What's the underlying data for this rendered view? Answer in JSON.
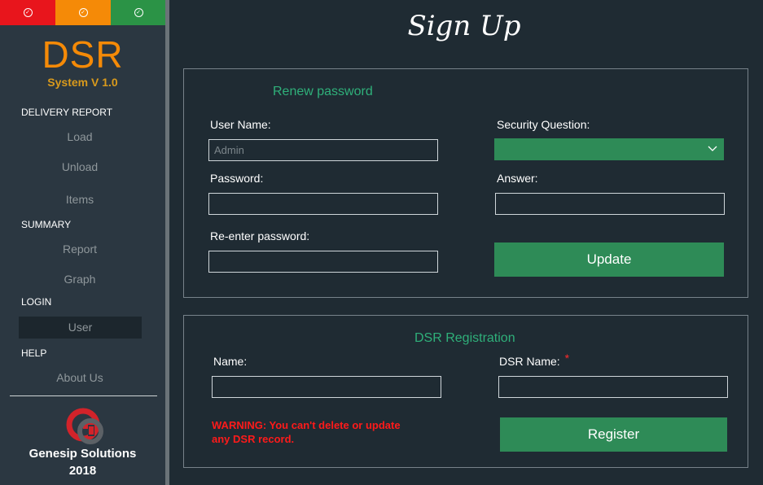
{
  "window_controls": [
    {
      "name": "close",
      "color": "#e8151c"
    },
    {
      "name": "minimize",
      "color": "#f58a07"
    },
    {
      "name": "maximize",
      "color": "#2b9346"
    }
  ],
  "sidebar": {
    "logo_text": "DSR",
    "logo_sub": "System V 1.0",
    "sections": [
      {
        "heading": "DELIVERY REPORT",
        "items": [
          "Load",
          "Unload",
          "Items"
        ]
      },
      {
        "heading": "SUMMARY",
        "items": [
          "Report",
          "Graph"
        ]
      },
      {
        "heading": "LOGIN",
        "items": [
          "User"
        ]
      },
      {
        "heading": "HELP",
        "items": [
          "About Us"
        ]
      }
    ],
    "active_item": "User",
    "company": "Genesip Solutions",
    "year": "2018"
  },
  "main": {
    "title": "Sign Up",
    "renew": {
      "title": "Renew password",
      "username_label": "User Name:",
      "username_placeholder": "Admin",
      "password_label": "Password:",
      "reenter_label": "Re-enter password:",
      "security_label": "Security Question:",
      "answer_label": "Answer:",
      "update_label": "Update"
    },
    "registration": {
      "title": "DSR Registration",
      "name_label": "Name:",
      "dsr_name_label": "DSR Name:",
      "required_mark": "*",
      "warning_line1": "WARNING:  You can't delete or update",
      "warning_line2": "any DSR record.",
      "register_label": "Register"
    }
  },
  "colors": {
    "accent_green": "#2e8b57",
    "title_green": "#2fb07a",
    "logo_orange": "#f58a07",
    "warning_red": "#ff1a1a"
  }
}
